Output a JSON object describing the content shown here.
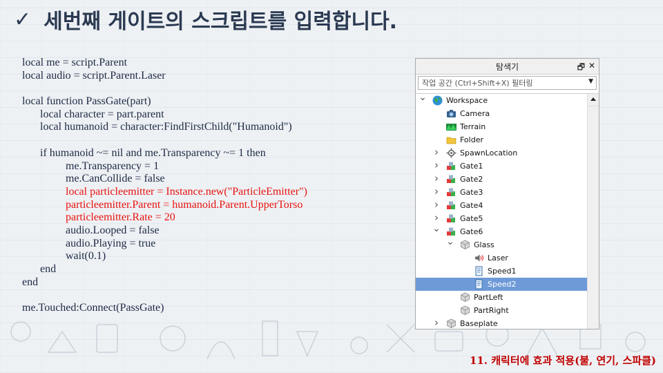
{
  "slide": {
    "title": "세번째 게이트의 스크립트를 입력합니다.",
    "check_glyph": "✓",
    "footer": "11. 캐릭터에 효과 적용(불, 연기, 스파클)"
  },
  "code_lines": [
    {
      "text": "local me = script.Parent",
      "indent": 0,
      "red": false
    },
    {
      "text": "local audio = script.Parent.Laser",
      "indent": 0,
      "red": false
    },
    {
      "text": "",
      "indent": 0,
      "red": false
    },
    {
      "text": "local function PassGate(part)",
      "indent": 0,
      "red": false
    },
    {
      "text": "local character = part.parent",
      "indent": 1,
      "red": false
    },
    {
      "text": "local humanoid = character:FindFirstChild(\"Humanoid\")",
      "indent": 1,
      "red": false
    },
    {
      "text": "",
      "indent": 0,
      "red": false
    },
    {
      "text": "if humanoid ~= nil and me.Transparency ~= 1 then",
      "indent": 1,
      "red": false
    },
    {
      "text": "me.Transparency = 1",
      "indent": 2,
      "red": false
    },
    {
      "text": "me.CanCollide = false",
      "indent": 2,
      "red": false
    },
    {
      "text": "local particleemitter = Instance.new(\"ParticleEmitter\")",
      "indent": 2,
      "red": true
    },
    {
      "text": "particleemitter.Parent = humanoid.Parent.UpperTorso",
      "indent": 2,
      "red": true
    },
    {
      "text": "particleemitter.Rate = 20",
      "indent": 2,
      "red": true
    },
    {
      "text": "audio.Looped = false",
      "indent": 2,
      "red": false
    },
    {
      "text": "audio.Playing = true",
      "indent": 2,
      "red": false
    },
    {
      "text": "wait(0.1)",
      "indent": 2,
      "red": false
    },
    {
      "text": "end",
      "indent": 1,
      "red": false
    },
    {
      "text": "end",
      "indent": 0,
      "red": false
    },
    {
      "text": "",
      "indent": 0,
      "red": false
    },
    {
      "text": "me.Touched:Connect(PassGate)",
      "indent": 0,
      "red": false
    }
  ],
  "explorer": {
    "title": "탐색기",
    "dock_glyph": "🗗",
    "close_glyph": "✕",
    "filter_placeholder": "작업 공간 (Ctrl+Shift+X) 필터링",
    "items": [
      {
        "label": "Workspace",
        "depth": 0,
        "chevron": "down",
        "icon": "globe-icon",
        "selected": false
      },
      {
        "label": "Camera",
        "depth": 1,
        "chevron": "none",
        "icon": "camera-icon",
        "selected": false
      },
      {
        "label": "Terrain",
        "depth": 1,
        "chevron": "none",
        "icon": "terrain-icon",
        "selected": false
      },
      {
        "label": "Folder",
        "depth": 1,
        "chevron": "none",
        "icon": "folder-icon",
        "selected": false
      },
      {
        "label": "SpawnLocation",
        "depth": 1,
        "chevron": "right",
        "icon": "spawn-icon",
        "selected": false
      },
      {
        "label": "Gate1",
        "depth": 1,
        "chevron": "right",
        "icon": "model-icon",
        "selected": false
      },
      {
        "label": "Gate2",
        "depth": 1,
        "chevron": "right",
        "icon": "model-icon",
        "selected": false
      },
      {
        "label": "Gate3",
        "depth": 1,
        "chevron": "right",
        "icon": "model-icon",
        "selected": false
      },
      {
        "label": "Gate4",
        "depth": 1,
        "chevron": "right",
        "icon": "model-icon",
        "selected": false
      },
      {
        "label": "Gate5",
        "depth": 1,
        "chevron": "right",
        "icon": "model-icon",
        "selected": false
      },
      {
        "label": "Gate6",
        "depth": 1,
        "chevron": "down",
        "icon": "model-icon",
        "selected": false
      },
      {
        "label": "Glass",
        "depth": 2,
        "chevron": "down",
        "icon": "part-icon",
        "selected": false
      },
      {
        "label": "Laser",
        "depth": 3,
        "chevron": "none",
        "icon": "sound-icon",
        "selected": false
      },
      {
        "label": "Speed1",
        "depth": 3,
        "chevron": "none",
        "icon": "script-icon",
        "selected": false
      },
      {
        "label": "Speed2",
        "depth": 3,
        "chevron": "none",
        "icon": "script-icon",
        "selected": true
      },
      {
        "label": "PartLeft",
        "depth": 2,
        "chevron": "none",
        "icon": "part-icon",
        "selected": false
      },
      {
        "label": "PartRight",
        "depth": 2,
        "chevron": "none",
        "icon": "part-icon",
        "selected": false
      },
      {
        "label": "Baseplate",
        "depth": 1,
        "chevron": "right",
        "icon": "part-icon",
        "selected": false
      }
    ]
  },
  "colors": {
    "code_text": "#1d2a44",
    "code_highlight": "#e8120e",
    "footer_text": "#c00000",
    "selection": "#6e9bd8"
  }
}
